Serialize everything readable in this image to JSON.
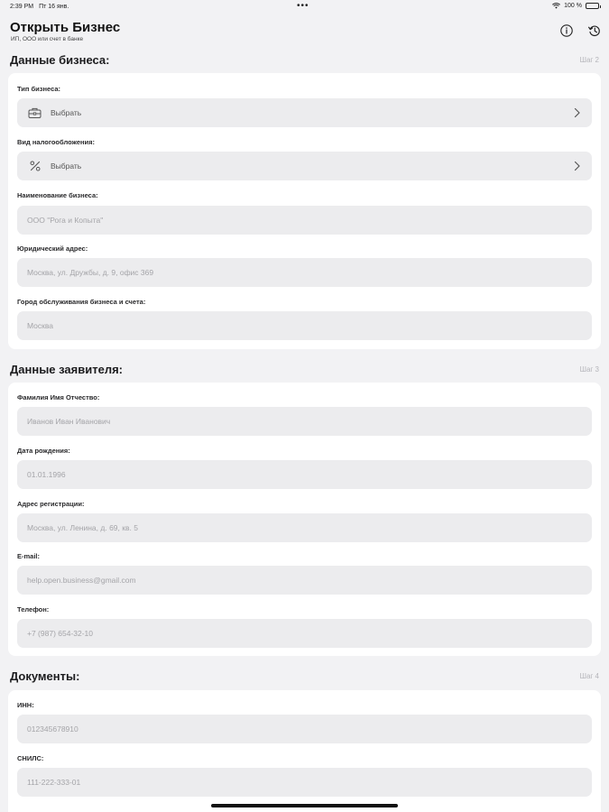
{
  "status_bar": {
    "time": "2:39 PM",
    "date": "Пт 16 янв.",
    "dots": "•••",
    "battery_text": "100 %"
  },
  "header": {
    "title": "Открыть Бизнес",
    "subtitle": "ИП, ООО или счет в банке"
  },
  "sections": {
    "business": {
      "title": "Данные бизнеса:",
      "step": "Шаг 2",
      "business_type": {
        "label": "Тип бизнеса:",
        "value": "Выбрать",
        "icon": "briefcase-icon"
      },
      "tax_type": {
        "label": "Вид налогообложения:",
        "value": "Выбрать",
        "icon": "percent-icon"
      },
      "business_name": {
        "label": "Наименование бизнеса:",
        "placeholder": "ООО \"Рога и Копыта\""
      },
      "legal_address": {
        "label": "Юридический адрес:",
        "placeholder": "Москва, ул. Дружбы, д. 9, офис 369"
      },
      "service_city": {
        "label": "Город обслуживания бизнеса и счета:",
        "placeholder": "Москва"
      }
    },
    "applicant": {
      "title": "Данные заявителя:",
      "step": "Шаг 3",
      "full_name": {
        "label": "Фамилия Имя Отчество:",
        "placeholder": "Иванов Иван Иванович"
      },
      "birth_date": {
        "label": "Дата рождения:",
        "placeholder": "01.01.1996"
      },
      "reg_address": {
        "label": "Адрес регистрации:",
        "placeholder": "Москва, ул. Ленина, д. 69, кв. 5"
      },
      "email": {
        "label": "E-mail:",
        "placeholder": "help.open.business@gmail.com"
      },
      "phone": {
        "label": "Телефон:",
        "placeholder": "+7 (987) 654-32-10"
      }
    },
    "documents": {
      "title": "Документы:",
      "step": "Шаг 4",
      "inn": {
        "label": "ИНН:",
        "placeholder": "012345678910"
      },
      "snils": {
        "label": "СНИЛС:",
        "placeholder": "111-222-333-01"
      }
    }
  }
}
